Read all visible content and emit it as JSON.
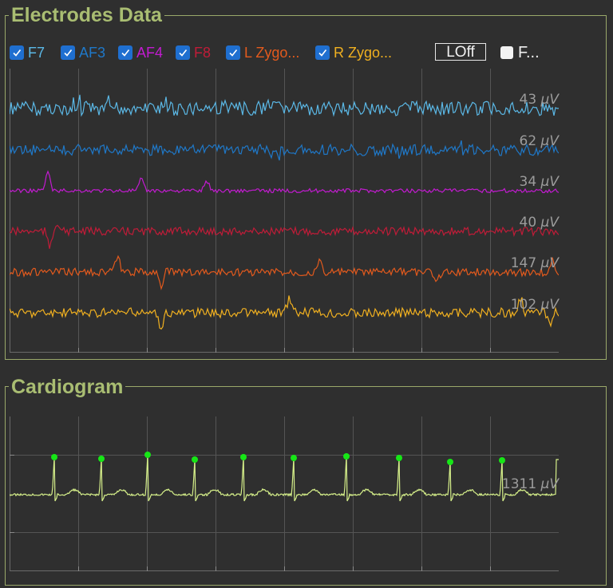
{
  "electrodes_panel": {
    "title": "Electrodes Data",
    "channels": [
      {
        "name": "F7",
        "color": "#5bb8e6",
        "checked": true,
        "scale": "43",
        "unit": "μV"
      },
      {
        "name": "AF3",
        "color": "#1f78c8",
        "checked": true,
        "scale": "62",
        "unit": "μV"
      },
      {
        "name": "AF4",
        "color": "#c21bd0",
        "checked": true,
        "scale": "34",
        "unit": "μV"
      },
      {
        "name": "F8",
        "color": "#c01c38",
        "checked": true,
        "scale": "40",
        "unit": "μV"
      },
      {
        "name": "L Zygo...",
        "color": "#e35a1d",
        "checked": true,
        "scale": "147",
        "unit": "μV"
      },
      {
        "name": "R Zygo...",
        "color": "#f0b020",
        "checked": true,
        "scale": "102",
        "unit": "μV"
      }
    ],
    "loff_button": "LOff",
    "filter_checkbox": {
      "label": "F...",
      "checked": false
    }
  },
  "cardiogram_panel": {
    "title": "Cardiogram",
    "trace_color": "#d6f08a",
    "peak_marker_color": "#16e616",
    "peak_count": 10,
    "scale": "1311",
    "unit": "μV"
  },
  "colors": {
    "background": "#2f2f2f",
    "title": "#a9bd72",
    "panel_border": "#9aa86a",
    "grid": "#555555"
  }
}
